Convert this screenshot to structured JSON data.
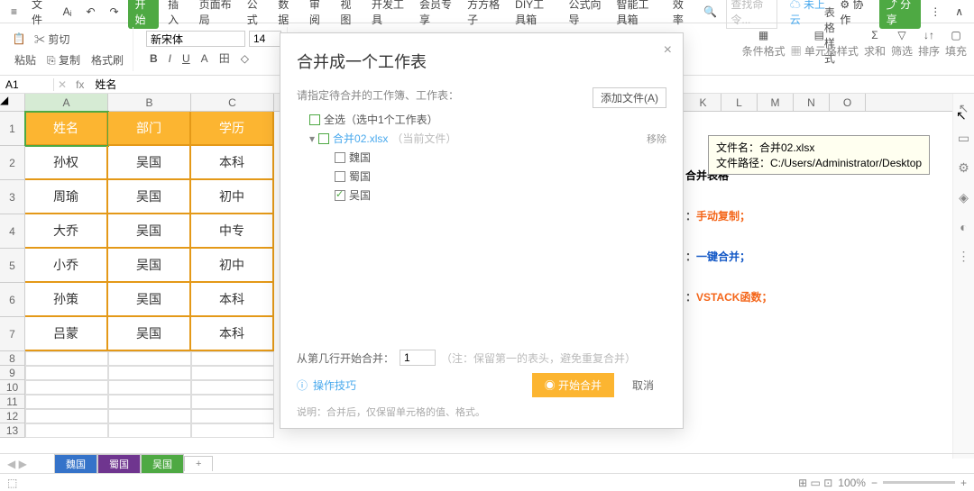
{
  "menubar": {
    "file": "文件",
    "undo": "↶",
    "redo": "↷",
    "start": "开始",
    "insert": "插入",
    "layout": "页面布局",
    "formula": "公式",
    "data": "数据",
    "review": "审阅",
    "view": "视图",
    "dev": "开发工具",
    "member": "会员专享",
    "solution": "方方格子",
    "diy": "DIY工具箱",
    "fx": "公式向导",
    "smart": "智能工具箱",
    "eff": "效率",
    "searchPh": "查找命令...",
    "cloud": "未上云",
    "coop": "协作",
    "share": "分享"
  },
  "ribbon": {
    "paste": "粘贴",
    "cut": "剪切",
    "copy": "复制",
    "painter": "格式刷",
    "fontName": "新宋体",
    "fontSize": "14",
    "bold": "B",
    "italic": "I",
    "underline": "U",
    "strike": "A",
    "border": "田",
    "fill": "◇",
    "condFmt": "条件格式",
    "tblFmt": "表格样式",
    "cellFmt": "单元格样式",
    "sum": "求和",
    "filter": "筛选",
    "sort": "排序",
    "fillv": "填充"
  },
  "formulaBar": {
    "name": "A1",
    "fx": "fx",
    "value": "姓名"
  },
  "columns": [
    "A",
    "B",
    "C"
  ],
  "farCols": [
    "K",
    "L",
    "M",
    "N",
    "O"
  ],
  "rows": [
    "1",
    "2",
    "3",
    "4",
    "5",
    "6",
    "7",
    "8",
    "9",
    "10",
    "11",
    "12",
    "13"
  ],
  "table": {
    "header": [
      "姓名",
      "部门",
      "学历"
    ],
    "data": [
      [
        "孙权",
        "吴国",
        "本科"
      ],
      [
        "周瑜",
        "吴国",
        "初中"
      ],
      [
        "大乔",
        "吴国",
        "中专"
      ],
      [
        "小乔",
        "吴国",
        "初中"
      ],
      [
        "孙策",
        "吴国",
        "本科"
      ],
      [
        "吕蒙",
        "吴国",
        "本科"
      ]
    ]
  },
  "dialog": {
    "title": "合并成一个工作表",
    "sub": "请指定待合并的工作簿、工作表：",
    "addFile": "添加文件(A)",
    "selectAll": "全选（选中1个工作表）",
    "fileName": "合并02.xlsx",
    "fileNote": "（当前文件）",
    "remove": "移除",
    "sheets": [
      "魏国",
      "蜀国",
      "吴国"
    ],
    "checked": [
      false,
      false,
      true
    ],
    "fromLabel": "从第几行开始合并：",
    "fromVal": "1",
    "fromNote": "（注：保留第一的表头，避免重复合并）",
    "tip": "操作技巧",
    "startBtn": "开始合并",
    "cancel": "取消",
    "note": "说明：合并后，仅保留单元格的值、格式。"
  },
  "tooltip": {
    "l1": "文件名：合并02.xlsx",
    "l2": "文件路径：C:/Users/Administrator/Desktop"
  },
  "rightText": {
    "r1": "合并表格",
    "r2": "手动复制；",
    "r2p": "：",
    "r3": "一键合并；",
    "r3p": "：",
    "r4": "VSTACK函数；",
    "r4p": "："
  },
  "tabs": {
    "t1": "魏国",
    "t2": "蜀国",
    "t3": "吴国",
    "plus": "+"
  },
  "status": {
    "zoom": "100%",
    "minus": "−",
    "plus": "+"
  }
}
